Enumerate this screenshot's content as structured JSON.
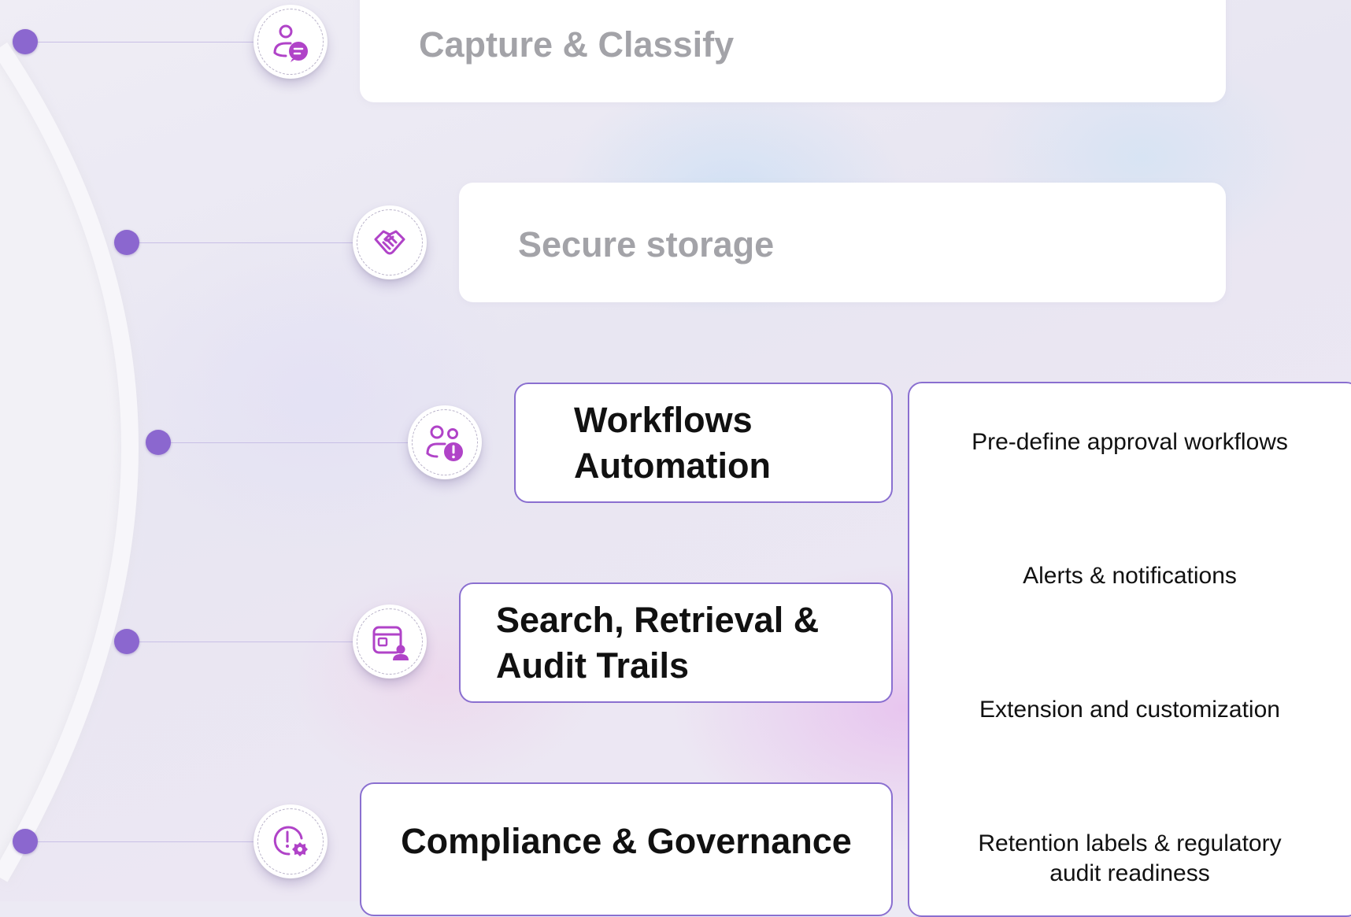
{
  "stages": [
    {
      "label": "Capture & Classify",
      "icon": "person-chat-icon",
      "style": "plain"
    },
    {
      "label": "Secure storage",
      "icon": "handshake-icon",
      "style": "plain"
    },
    {
      "label": "Workflows Automation",
      "icon": "people-alert-icon",
      "style": "outlined"
    },
    {
      "label": "Search, Retrieval & Audit Trails",
      "icon": "window-person-icon",
      "style": "outlined"
    },
    {
      "label": "Compliance & Governance",
      "icon": "alert-settings-icon",
      "style": "outlined"
    }
  ],
  "details": [
    "Pre-define approval workflows",
    "Alerts & notifications",
    "Extension and customization",
    "Retention labels & regulatory audit readiness"
  ],
  "colors": {
    "accent": "#8b67cf",
    "icon": "#b043c8",
    "outline": "#8a6fd0",
    "muted_text": "#a3a3a8"
  }
}
